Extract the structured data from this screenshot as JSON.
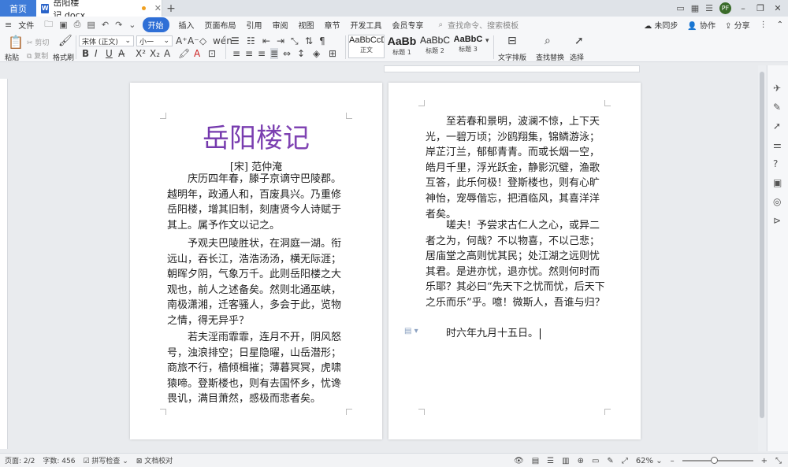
{
  "titlebar": {
    "home_tab": "首页",
    "doc_name": "岳阳楼记.docx",
    "doc_icon": "W",
    "avatar_text": "PF"
  },
  "menubar": {
    "file": "文件",
    "tabs": [
      "开始",
      "插入",
      "页面布局",
      "引用",
      "审阅",
      "视图",
      "章节",
      "开发工具",
      "会员专享"
    ],
    "active_tab": "开始",
    "search_placeholder": "查找命令、搜索模板",
    "sync": "未同步",
    "collab": "协作",
    "share": "分享"
  },
  "ribbon": {
    "paste": "粘贴",
    "cut": "剪切",
    "copy": "复制",
    "format_painter": "格式刷",
    "font_name": "宋体 (正文)",
    "font_size": "小一",
    "styles": [
      {
        "sample": "AaBbCcDd",
        "label": "正文"
      },
      {
        "sample": "AaBb",
        "label": "标题 1"
      },
      {
        "sample": "AaBbC",
        "label": "标题 2"
      },
      {
        "sample": "AaBbC",
        "label": "标题 3"
      }
    ],
    "text_layout": "文字排版",
    "find_replace": "查找替换",
    "select": "选择"
  },
  "document": {
    "title": "岳阳楼记",
    "author": "[宋] 范仲淹",
    "page1_paragraphs": [
      "庆历四年春，滕子京谪守巴陵郡。越明年，政通人和，百废具兴。乃重修岳阳楼，增其旧制，刻唐贤今人诗赋于其上。属予作文以记之。",
      "予观夫巴陵胜状，在洞庭一湖。衔远山，吞长江，浩浩汤汤，横无际涯；朝晖夕阴，气象万千。此则岳阳楼之大观也，前人之述备矣。然则北通巫峡，南极潇湘，迁客骚人，多会于此，览物之情，得无异乎？",
      "若夫淫雨霏霏，连月不开，阴风怒号，浊浪排空；日星隐曜，山岳潜形；商旅不行，樯倾楫摧；薄暮冥冥，虎啸猿啼。登斯楼也，则有去国怀乡，忧谗畏讥，满目萧然，感极而悲者矣。"
    ],
    "page2_paragraphs": [
      "至若春和景明，波澜不惊，上下天光，一碧万顷；沙鸥翔集，锦鳞游泳；岸芷汀兰，郁郁青青。而或长烟一空，皓月千里，浮光跃金，静影沉璧，渔歌互答，此乐何极！登斯楼也，则有心旷神怡，宠辱偕忘，把酒临风，其喜洋洋者矣。",
      "嗟夫！予尝求古仁人之心，或异二者之为，何哉？不以物喜，不以己悲；居庙堂之高则忧其民；处江湖之远则忧其君。是进亦忧，退亦忧。然则何时而乐耶？其必曰“先天下之忧而忧，后天下之乐而乐”乎。噫！微斯人，吾谁与归？",
      "时六年九月十五日。"
    ]
  },
  "statusbar": {
    "page": "页面: 2/2",
    "words": "字数: 456",
    "spellcheck": "拼写检查",
    "proofread": "文档校对",
    "zoom": "62%",
    "zoom_level": 0.45
  },
  "colors": {
    "accent": "#2f6fd6",
    "title_purple": "#7a3fae"
  }
}
